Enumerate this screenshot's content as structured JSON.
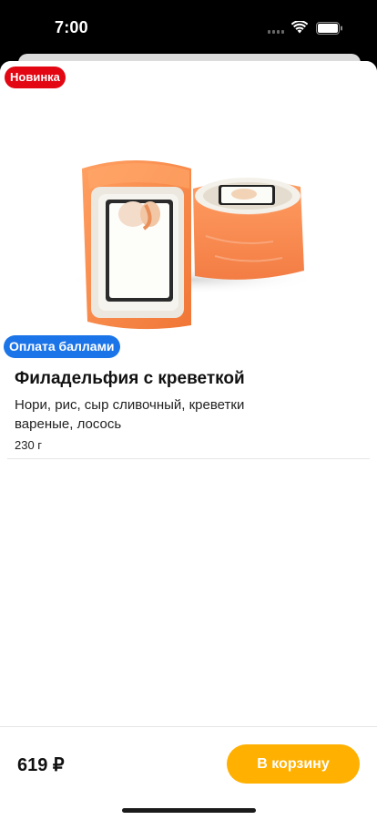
{
  "status_bar": {
    "time": "7:00"
  },
  "product": {
    "badge_new": "Новинка",
    "badge_points": "Оплата баллами",
    "title": "Филадельфия с креветкой",
    "description": "Нори, рис, сыр сливочный, креветки вареные, лосось",
    "weight": "230 г"
  },
  "footer": {
    "price": "619 ₽",
    "add_to_cart_label": "В корзину"
  },
  "colors": {
    "accent": "#ffb000",
    "badge_new": "#e30613",
    "badge_points": "#1c75e8"
  },
  "icons": [
    "cellular-signal-icon",
    "wifi-icon",
    "battery-icon"
  ]
}
